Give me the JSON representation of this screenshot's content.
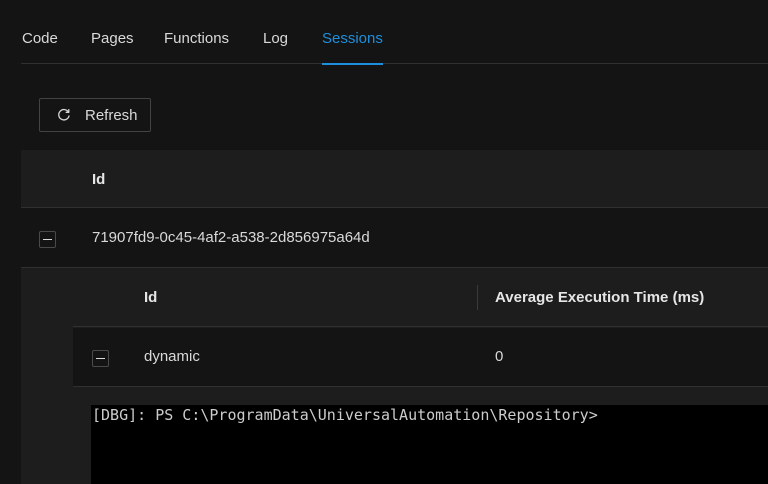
{
  "tabs": [
    {
      "label": "Code",
      "active": false
    },
    {
      "label": "Pages",
      "active": false
    },
    {
      "label": "Functions",
      "active": false
    },
    {
      "label": "Log",
      "active": false
    },
    {
      "label": "Sessions",
      "active": true
    }
  ],
  "toolbar": {
    "refresh_label": "Refresh",
    "refresh_icon": "refresh-icon"
  },
  "sessions_table": {
    "columns": [
      "Id"
    ],
    "rows": [
      {
        "id": "71907fd9-0c45-4af2-a538-2d856975a64d",
        "expanded": true
      }
    ]
  },
  "runspaces_table": {
    "columns": [
      "Id",
      "Average Execution Time (ms)"
    ],
    "rows": [
      {
        "id": "dynamic",
        "avg_time": "0",
        "expanded": true
      }
    ]
  },
  "terminal": {
    "prompt": "[DBG]: PS C:\\ProgramData\\UniversalAutomation\\Repository>"
  },
  "colors": {
    "accent": "#1d8fdc",
    "background": "#141414",
    "header_bg": "#1d1d1d",
    "terminal_bg": "#000000"
  }
}
